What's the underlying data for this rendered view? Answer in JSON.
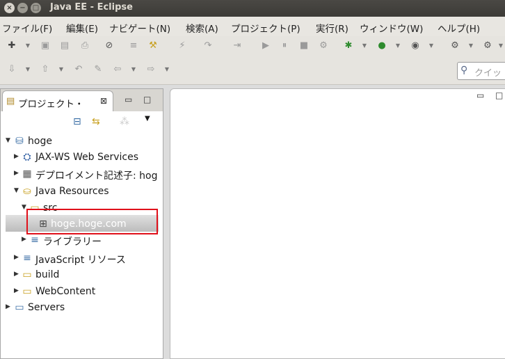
{
  "window": {
    "title": "Java EE - Eclipse",
    "close": "×",
    "minimize": "−",
    "maximize": "□"
  },
  "menu": [
    "ファイル(F)",
    "編集(E)",
    "ナビゲート(N)",
    "検索(A)",
    "プロジェクト(P)",
    "実行(R)",
    "ウィンドウ(W)",
    "ヘルプ(H)"
  ],
  "toolbar": {
    "row1": [
      {
        "icon": "new-icon",
        "glyph": "✚"
      },
      {
        "icon": "save-icon",
        "glyph": "▣"
      },
      {
        "icon": "save-all-icon",
        "glyph": "▤"
      },
      {
        "icon": "print-icon",
        "glyph": "⎙"
      },
      {
        "icon": "skip-breakpoints-icon",
        "glyph": "⊘"
      },
      {
        "icon": "build-icon",
        "glyph": "≡"
      },
      {
        "icon": "refactor-icon",
        "glyph": "⚒"
      },
      {
        "icon": "connect-icon",
        "glyph": "⚡"
      },
      {
        "icon": "step-into-icon",
        "glyph": "↷"
      },
      {
        "icon": "step-over-icon",
        "glyph": "⇥"
      },
      {
        "icon": "resume-icon",
        "glyph": "▶"
      },
      {
        "icon": "suspend-icon",
        "glyph": "⏸"
      },
      {
        "icon": "terminate-icon",
        "glyph": "■"
      },
      {
        "icon": "disconnect-icon",
        "glyph": "⚙"
      },
      {
        "icon": "debug-icon",
        "glyph": "✱"
      },
      {
        "icon": "run-icon",
        "glyph": "●"
      },
      {
        "icon": "coverage-icon",
        "glyph": "◉"
      },
      {
        "icon": "external-tools-icon",
        "glyph": "⚙"
      },
      {
        "icon": "server-icon",
        "glyph": "⚙"
      }
    ],
    "row2": [
      {
        "icon": "annotation-next-icon",
        "glyph": "⇩"
      },
      {
        "icon": "annotation-prev-icon",
        "glyph": "⇧"
      },
      {
        "icon": "last-edit-icon",
        "glyph": "↶"
      },
      {
        "icon": "pin-icon",
        "glyph": "✎"
      },
      {
        "icon": "back-icon",
        "glyph": "⇦"
      },
      {
        "icon": "forward-icon",
        "glyph": "⇨"
      }
    ],
    "search_placeholder": "クイッ"
  },
  "project_explorer": {
    "tab_label": "プロジェクト・",
    "close_glyph": "⊠",
    "minimize_glyph": "▭",
    "maximize_glyph": "□",
    "view_menu_glyph": "▼",
    "collapse_glyph": "⊟",
    "link_glyph": "⇆",
    "filter_glyph": "⁂",
    "tree": [
      {
        "label": "hoge",
        "twisty": "▼",
        "glyph": "⛁",
        "icon": "dynamic-web-project-icon",
        "expanded": true
      },
      {
        "label": "JAX-WS Web Services",
        "twisty": "▶",
        "glyph": "⛭",
        "icon": "web-services-icon",
        "expanded": false
      },
      {
        "label": "デプロイメント記述子: hog",
        "twisty": "▶",
        "glyph": "▦",
        "icon": "deployment-descriptor-icon",
        "expanded": false
      },
      {
        "label": "Java Resources",
        "twisty": "▼",
        "glyph": "⛀",
        "icon": "java-resources-icon",
        "expanded": true
      },
      {
        "label": "src",
        "twisty": "▼",
        "glyph": "▭",
        "icon": "source-folder-icon",
        "expanded": true
      },
      {
        "label": "hoge.hoge.com",
        "twisty": "",
        "glyph": "⊞",
        "icon": "package-icon",
        "expanded": false
      },
      {
        "label": "ライブラリー",
        "twisty": "▶",
        "glyph": "≡",
        "icon": "libraries-icon",
        "expanded": false
      },
      {
        "label": "JavaScript リソース",
        "twisty": "▶",
        "glyph": "≡",
        "icon": "javascript-resources-icon",
        "expanded": false
      },
      {
        "label": "build",
        "twisty": "▶",
        "glyph": "▭",
        "icon": "folder-icon",
        "expanded": false
      },
      {
        "label": "WebContent",
        "twisty": "▶",
        "glyph": "▭",
        "icon": "folder-icon",
        "expanded": false
      },
      {
        "label": "Servers",
        "twisty": "▶",
        "glyph": "▭",
        "icon": "servers-folder-icon",
        "expanded": false
      }
    ],
    "selected_item": "hoge.hoge.com"
  },
  "editor": {
    "minimize_glyph": "▭",
    "maximize_glyph": "□"
  },
  "colors": {
    "highlight_box": "#e0101a",
    "title_bar": "#3c3b37",
    "menu_bar": "#e8e6e1"
  }
}
